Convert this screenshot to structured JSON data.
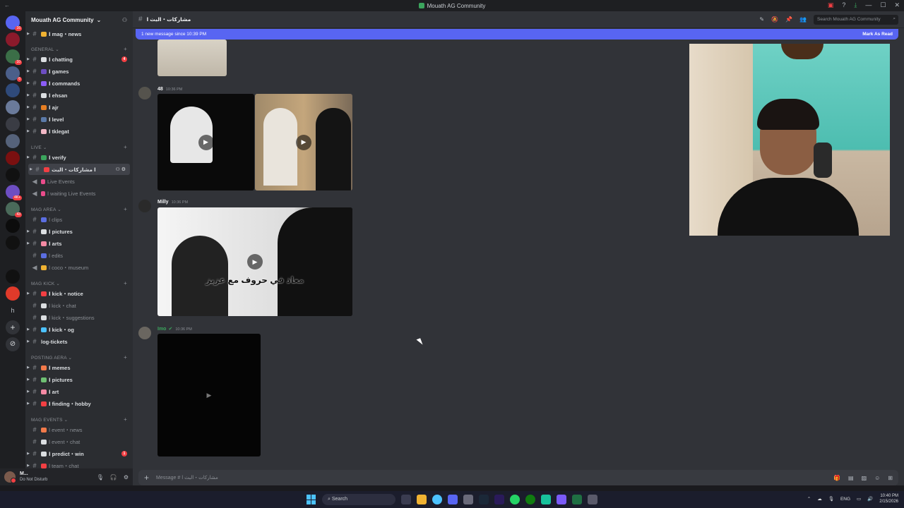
{
  "window": {
    "title": "Mouath AG Community",
    "back_glyph": "←"
  },
  "server": {
    "name": "Mouath AG Community"
  },
  "rail": {
    "badges": [
      "16",
      "10",
      "6",
      "4K+",
      "43"
    ]
  },
  "sidebar": {
    "top_channel": {
      "label": "ا mag・news"
    },
    "categories": [
      {
        "label": "GENERAL",
        "channels": [
          {
            "label": "ا chatting",
            "badge": "4"
          },
          {
            "label": "ا games"
          },
          {
            "label": "ا commands"
          },
          {
            "label": "ا ehsan"
          },
          {
            "label": "ا ajr"
          },
          {
            "label": "ا level"
          },
          {
            "label": "ا tklegat"
          }
        ]
      },
      {
        "label": "LIVE",
        "channels": [
          {
            "label": "ا verify"
          },
          {
            "label": "ا مشاركات・البث",
            "selected": true
          },
          {
            "label": "Live Events",
            "muted": true
          },
          {
            "label": "ا waiting Live Events",
            "muted": true
          }
        ]
      },
      {
        "label": "MAG AREA",
        "channels": [
          {
            "label": "ا clips",
            "muted": true
          },
          {
            "label": "ا pictures"
          },
          {
            "label": "ا arts"
          },
          {
            "label": "ا edits",
            "muted": true
          },
          {
            "label": "ا coco・museum",
            "muted": true
          }
        ]
      },
      {
        "label": "MAG KICK",
        "channels": [
          {
            "label": "ا kick・notice"
          },
          {
            "label": "ا kick・chat",
            "muted": true
          },
          {
            "label": "ا kick・suggestions",
            "muted": true
          },
          {
            "label": "ا kick・og"
          },
          {
            "label": "log-tickets"
          }
        ]
      },
      {
        "label": "POSTING AERA",
        "channels": [
          {
            "label": "ا memes"
          },
          {
            "label": "ا pictures"
          },
          {
            "label": "ا art"
          },
          {
            "label": "ا finding・hobby"
          }
        ]
      },
      {
        "label": "MAG EVENTS",
        "channels": [
          {
            "label": "ا event・news",
            "muted": true
          },
          {
            "label": "ا event・chat",
            "muted": true
          },
          {
            "label": "ا predict・win",
            "badge": "1"
          },
          {
            "label": "ا team・chat",
            "muted": true
          }
        ]
      }
    ]
  },
  "user": {
    "name": "M...",
    "status": "Do Not Disturb"
  },
  "channel_header": {
    "name": "مشاركات・البث ا",
    "search_placeholder": "Search Mouath AG Community"
  },
  "banner": {
    "text": "1 new message since 10:39 PM",
    "action": "Mark As Read"
  },
  "messages": [
    {
      "author": "48",
      "time": "10:36 PM",
      "media": [
        "video",
        "video"
      ],
      "captions": [
        "",
        ""
      ]
    },
    {
      "author": "Milly",
      "time": "10:36 PM",
      "media": [
        "video"
      ],
      "captions": [
        "معاذ في حروف مع عزيز"
      ]
    },
    {
      "author": "Imo",
      "time": "10:36 PM",
      "media": [
        "video"
      ],
      "captions": [
        ""
      ]
    }
  ],
  "composer": {
    "placeholder": "Message # مشاركات・البث ا"
  },
  "taskbar": {
    "search_label": "Search",
    "lang": "ENG",
    "time": "10:40 PM",
    "date": "2/15/2026"
  }
}
